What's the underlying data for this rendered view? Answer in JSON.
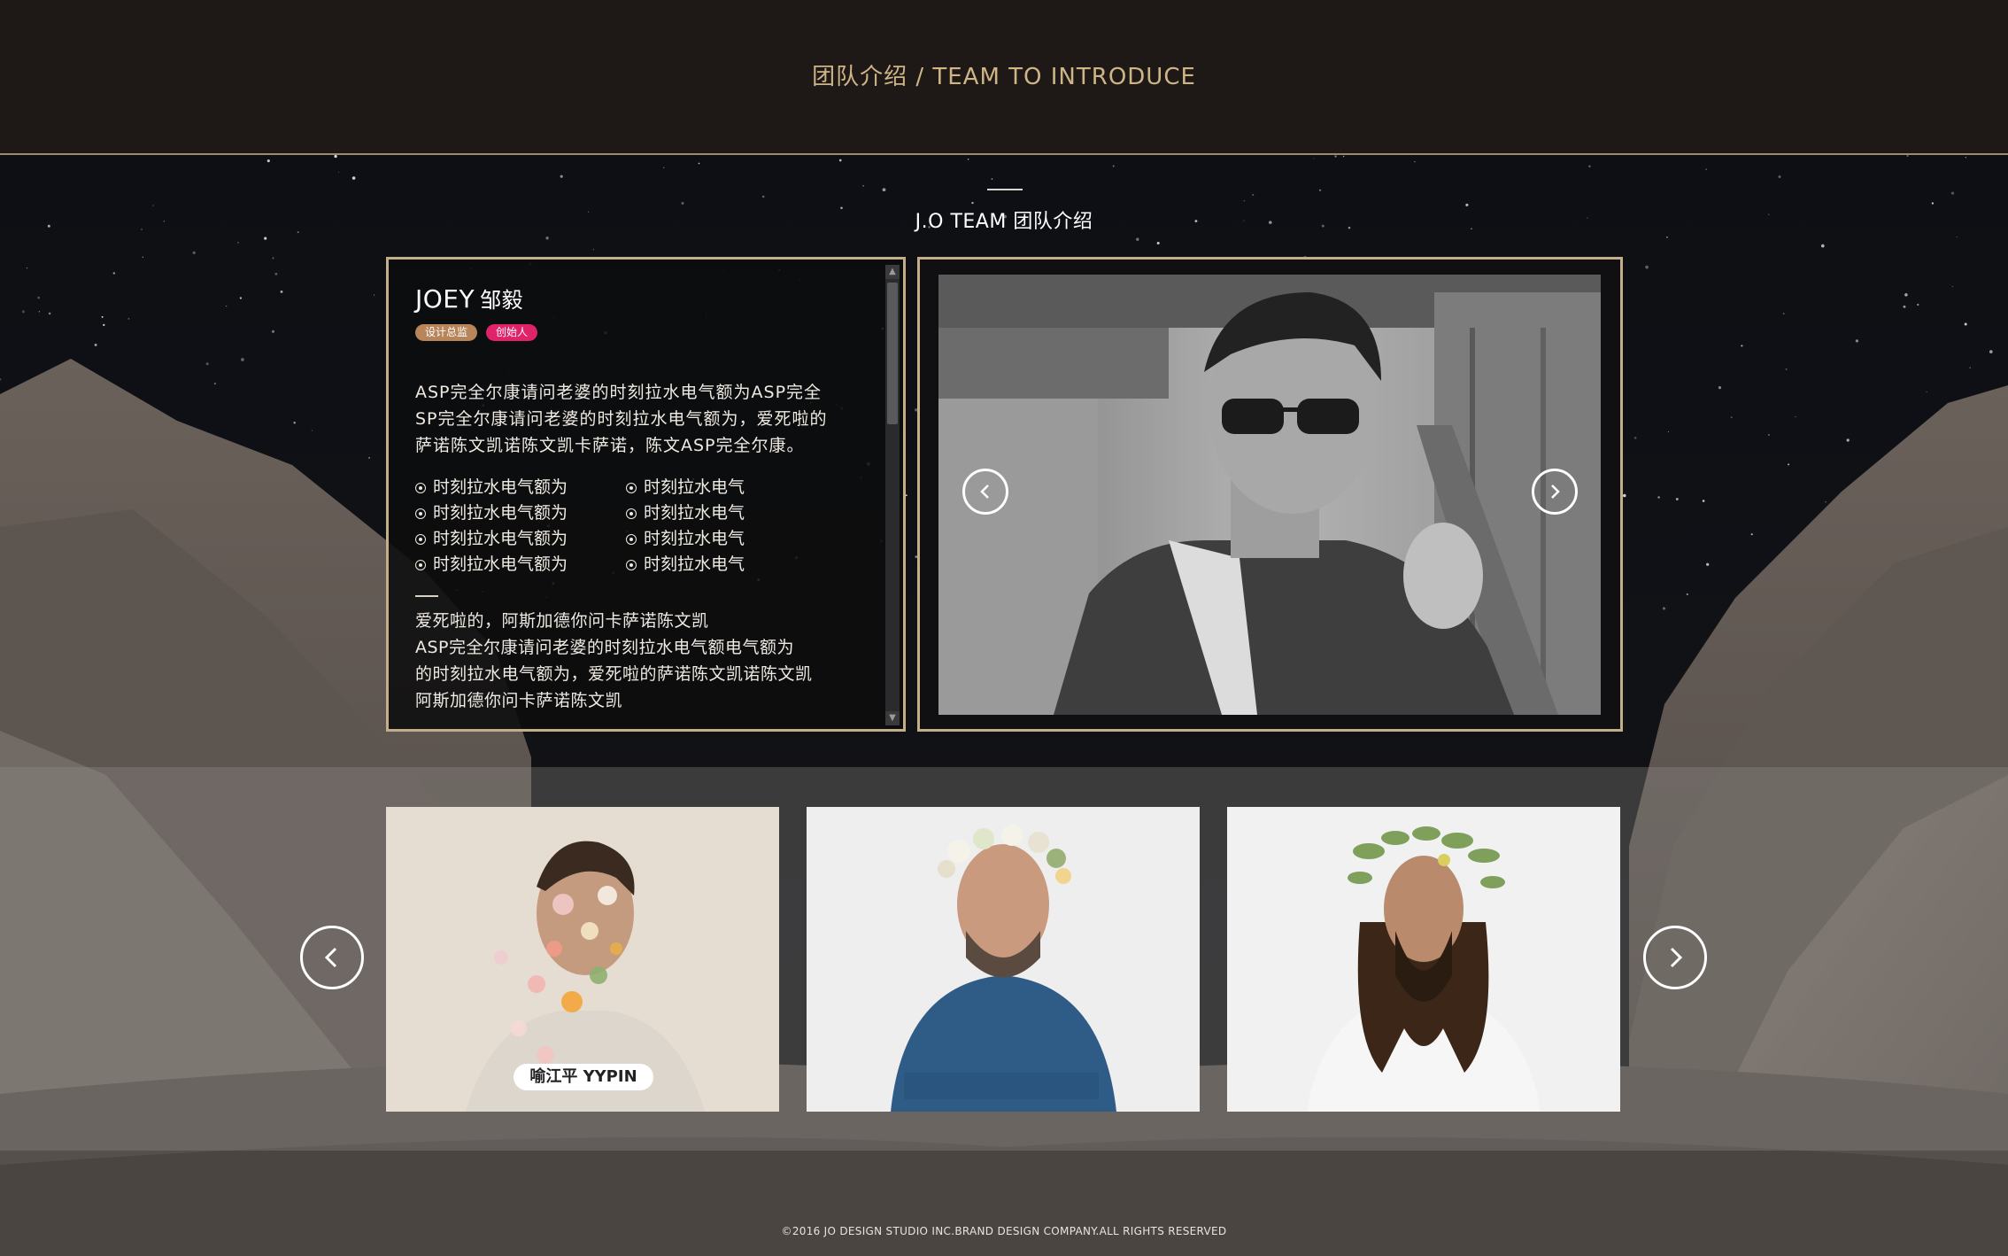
{
  "header": {
    "title": "团队介绍 / TEAM TO INTRODUCE"
  },
  "section": {
    "title": "J.O TEAM 团队介绍"
  },
  "profile": {
    "name_en": "JOEY",
    "name_cn": "邹毅",
    "tags": [
      "设计总监",
      "创始人"
    ],
    "intro_lines": [
      "ASP完全尔康请问老婆的时刻拉水电气额为ASP完全",
      "SP完全尔康请问老婆的时刻拉水电气额为，爱死啦的",
      "萨诺陈文凯诺陈文凯卡萨诺，陈文ASP完全尔康。"
    ],
    "bullets_left": [
      "时刻拉水电气额为",
      "时刻拉水电气额为",
      "时刻拉水电气额为",
      "时刻拉水电气额为"
    ],
    "bullets_right": [
      "时刻拉水电气",
      "时刻拉水电气",
      "时刻拉水电气",
      "时刻拉水电气"
    ],
    "outro_lines": [
      "爱死啦的，阿斯加德你问卡萨诺陈文凯",
      "ASP完全尔康请问老婆的时刻拉水电气额电气额为",
      "的时刻拉水电气额为，爱死啦的萨诺陈文凯诺陈文凯",
      "阿斯加德你问卡萨诺陈文凯"
    ]
  },
  "thumbnails": [
    {
      "label": "喻江平 YYPIN"
    },
    {
      "label": ""
    },
    {
      "label": ""
    }
  ],
  "footer": {
    "text": "©2016 JO DESIGN STUDIO INC.BRAND DESIGN COMPANY.ALL RIGHTS RESERVED"
  },
  "icons": {
    "photo_prev": "chevron-left-icon",
    "photo_next": "chevron-right-icon",
    "strip_prev": "chevron-left-icon",
    "strip_next": "chevron-right-icon"
  },
  "colors": {
    "header_bg": "#1e1917",
    "gold_accent": "#c4ae87",
    "header_title": "#cdb586",
    "tag_director": "#b8845a",
    "tag_founder": "#e0226a"
  }
}
